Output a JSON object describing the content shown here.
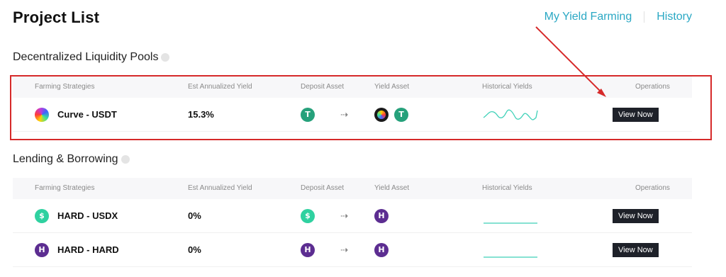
{
  "page": {
    "title": "Project List"
  },
  "top_links": {
    "my_yield_farming": "My Yield Farming",
    "history": "History"
  },
  "columns": {
    "farming_strategies": "Farming Strategies",
    "est_annualized_yield": "Est Annualized Yield",
    "deposit_asset": "Deposit Asset",
    "yield_asset": "Yield Asset",
    "historical_yields": "Historical Yields",
    "operations": "Operations"
  },
  "sections": [
    {
      "title": "Decentralized Liquidity Pools",
      "rows": [
        {
          "name": "Curve - USDT",
          "icon": "curve-icon",
          "yield": "15.3%",
          "deposit_asset": "usdt-icon",
          "yield_assets": [
            "curve-icon",
            "usdt-icon"
          ],
          "arrow": "⇢",
          "sparkline": "wavy",
          "button": "View Now"
        }
      ]
    },
    {
      "title": "Lending & Borrowing",
      "rows": [
        {
          "name": "HARD - USDX",
          "icon": "usdx-icon",
          "yield": "0%",
          "deposit_asset": "usdx-icon",
          "yield_assets": [
            "hard-icon"
          ],
          "arrow": "⇢",
          "sparkline": "flat",
          "button": "View Now"
        },
        {
          "name": "HARD - HARD",
          "icon": "hard-icon",
          "yield": "0%",
          "deposit_asset": "hard-icon",
          "yield_assets": [
            "hard-icon"
          ],
          "arrow": "⇢",
          "sparkline": "flat",
          "button": "View Now"
        }
      ]
    }
  ],
  "colors": {
    "link": "#2aa8c4",
    "highlight": "#d62a2a",
    "button_bg": "#1e2129",
    "sparkline": "#3ed1b8",
    "usdt": "#26a17b",
    "usdx": "#2fd1a0",
    "hard": "#5c2d91"
  }
}
